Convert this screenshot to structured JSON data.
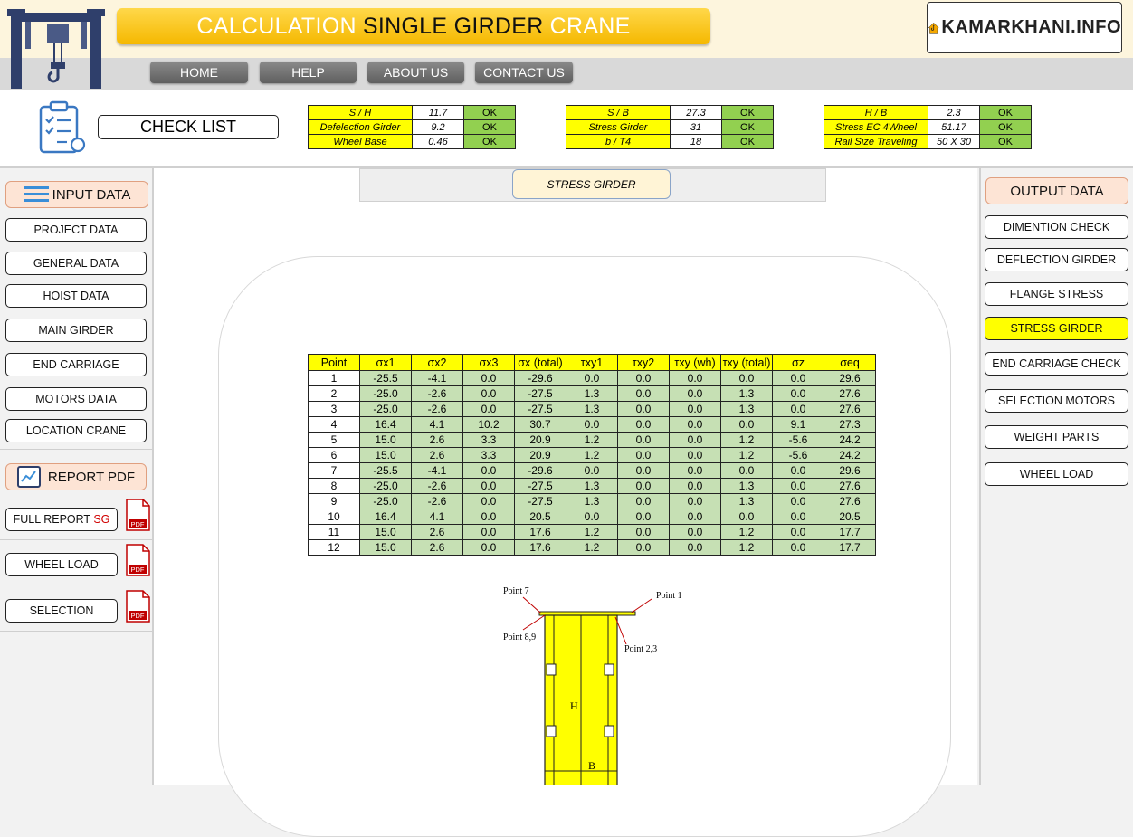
{
  "header": {
    "title_part1": "CALCULATION",
    "title_part2": "SINGLE GIRDER",
    "title_part3": "CRANE",
    "brand": "KAMARKHANI.INFO",
    "nav": [
      "HOME",
      "HELP",
      "ABOUT US",
      "CONTACT US"
    ]
  },
  "checklist": {
    "label": "CHECK LIST",
    "groups": [
      [
        {
          "label": "S / H",
          "value": "11.7",
          "status": "OK"
        },
        {
          "label": "Defelection Girder",
          "value": "9.2",
          "status": "OK"
        },
        {
          "label": "Wheel Base",
          "value": "0.46",
          "status": "OK"
        }
      ],
      [
        {
          "label": "S / B",
          "value": "27.3",
          "status": "OK"
        },
        {
          "label": "Stress Girder",
          "value": "31",
          "status": "OK"
        },
        {
          "label": "b / T4",
          "value": "18",
          "status": "OK"
        }
      ],
      [
        {
          "label": "H / B",
          "value": "2.3",
          "status": "OK"
        },
        {
          "label": "Stress EC  4Wheel",
          "value": "51.17",
          "status": "OK"
        },
        {
          "label": "Rail Size Traveling",
          "value": "50 X 30",
          "status": "OK"
        }
      ]
    ]
  },
  "left_panel": {
    "input_label": "INPUT DATA",
    "input_items": [
      "PROJECT DATA",
      "GENERAL DATA",
      "HOIST DATA",
      "MAIN GIRDER",
      "END CARRIAGE",
      "MOTORS DATA",
      "LOCATION CRANE"
    ],
    "report_label": "REPORT PDF",
    "report_items": [
      {
        "label": "FULL REPORT ",
        "suffix": "SG"
      },
      {
        "label": "WHEEL LOAD",
        "suffix": ""
      },
      {
        "label": "SELECTION",
        "suffix": ""
      }
    ],
    "pdf_text": "PDF"
  },
  "right_panel": {
    "output_label": "OUTPUT DATA",
    "items": [
      "DIMENTION CHECK",
      "DEFLECTION GIRDER",
      "FLANGE STRESS",
      "STRESS GIRDER",
      "END CARRIAGE CHECK",
      "SELECTION MOTORS",
      "WEIGHT PARTS",
      "WHEEL LOAD"
    ],
    "active_item": "STRESS GIRDER"
  },
  "main": {
    "tab_label": "STRESS GIRDER",
    "table": {
      "headers": [
        "Point",
        "σx1",
        "σx2",
        "σx3",
        "σx (total)",
        "τxy1",
        "τxy2",
        "τxy (wh)",
        "τxy (total)",
        "σz",
        "σeq"
      ],
      "rows": [
        [
          "1",
          "-25.5",
          "-4.1",
          "0.0",
          "-29.6",
          "0.0",
          "0.0",
          "0.0",
          "0.0",
          "0.0",
          "29.6"
        ],
        [
          "2",
          "-25.0",
          "-2.6",
          "0.0",
          "-27.5",
          "1.3",
          "0.0",
          "0.0",
          "1.3",
          "0.0",
          "27.6"
        ],
        [
          "3",
          "-25.0",
          "-2.6",
          "0.0",
          "-27.5",
          "1.3",
          "0.0",
          "0.0",
          "1.3",
          "0.0",
          "27.6"
        ],
        [
          "4",
          "16.4",
          "4.1",
          "10.2",
          "30.7",
          "0.0",
          "0.0",
          "0.0",
          "0.0",
          "9.1",
          "27.3"
        ],
        [
          "5",
          "15.0",
          "2.6",
          "3.3",
          "20.9",
          "1.2",
          "0.0",
          "0.0",
          "1.2",
          "-5.6",
          "24.2"
        ],
        [
          "6",
          "15.0",
          "2.6",
          "3.3",
          "20.9",
          "1.2",
          "0.0",
          "0.0",
          "1.2",
          "-5.6",
          "24.2"
        ],
        [
          "7",
          "-25.5",
          "-4.1",
          "0.0",
          "-29.6",
          "0.0",
          "0.0",
          "0.0",
          "0.0",
          "0.0",
          "29.6"
        ],
        [
          "8",
          "-25.0",
          "-2.6",
          "0.0",
          "-27.5",
          "1.3",
          "0.0",
          "0.0",
          "1.3",
          "0.0",
          "27.6"
        ],
        [
          "9",
          "-25.0",
          "-2.6",
          "0.0",
          "-27.5",
          "1.3",
          "0.0",
          "0.0",
          "1.3",
          "0.0",
          "27.6"
        ],
        [
          "10",
          "16.4",
          "4.1",
          "0.0",
          "20.5",
          "0.0",
          "0.0",
          "0.0",
          "0.0",
          "0.0",
          "20.5"
        ],
        [
          "11",
          "15.0",
          "2.6",
          "0.0",
          "17.6",
          "1.2",
          "0.0",
          "0.0",
          "1.2",
          "0.0",
          "17.7"
        ],
        [
          "12",
          "15.0",
          "2.6",
          "0.0",
          "17.6",
          "1.2",
          "0.0",
          "0.0",
          "1.2",
          "0.0",
          "17.7"
        ]
      ]
    },
    "diagram": {
      "labels": [
        "Point 7",
        "Point 1",
        "Point 8,9",
        "Point 2,3",
        "H",
        "B"
      ]
    }
  },
  "colors": {
    "title_yellow": "#f5b800",
    "ok_green": "#92d050",
    "label_yellow": "#ffff00",
    "cell_green": "#c6e0b4",
    "section_peach": "#fde4d5"
  }
}
